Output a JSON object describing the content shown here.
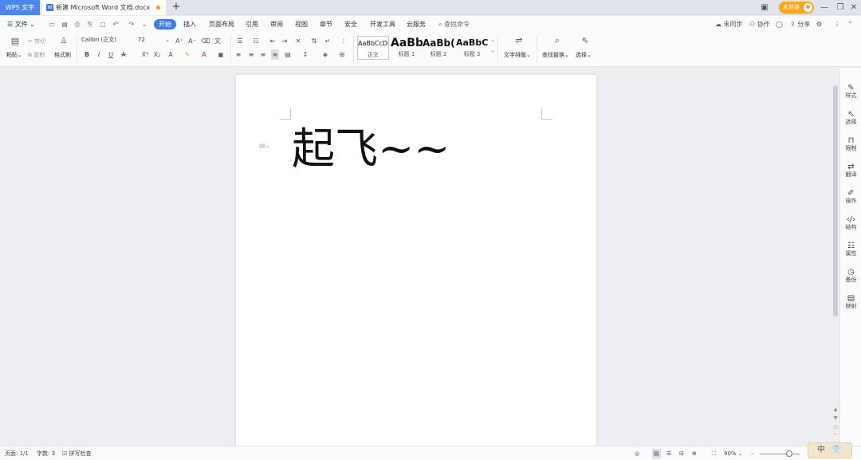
{
  "titlebar": {
    "app_tab": "WPS 文字",
    "doc_name": "新建 Microsoft Word 文档.docx",
    "doc_icon_letter": "W",
    "new_tab": "+",
    "login": "未登录"
  },
  "menu": {
    "file": "文件",
    "tabs": [
      "开始",
      "插入",
      "页面布局",
      "引用",
      "审阅",
      "视图",
      "章节",
      "安全",
      "开发工具",
      "云服务"
    ],
    "search": "查找命令",
    "right": [
      "未同步",
      "协作",
      "分享"
    ]
  },
  "ribbon": {
    "paste": "粘贴",
    "cut": "剪切",
    "copy": "复制",
    "format_painter": "格式刷",
    "font_name": "Calibri (正文)",
    "font_size": "72",
    "styles": [
      {
        "sample": "AaBbCcDd",
        "name": "正文"
      },
      {
        "sample": "AaBb",
        "name": "标题 1"
      },
      {
        "sample": "AaBb(",
        "name": "标题 2"
      },
      {
        "sample": "AaBbC",
        "name": "标题 3"
      }
    ],
    "text_layout": "文字排版",
    "find_replace": "查找替换",
    "select": "选择"
  },
  "document": {
    "text": "起飞~~"
  },
  "right_panel": [
    "样式",
    "选择",
    "限制",
    "翻译",
    "操作",
    "结构",
    "属性",
    "备份",
    "映射"
  ],
  "status": {
    "page": "页面: 1/1",
    "word_count": "字数: 3",
    "spell_check": "拼写检查",
    "zoom": "90%"
  },
  "ime": {
    "lang": "中"
  },
  "colors": {
    "accent": "#3d7ce8",
    "app_tab": "#4a88f0",
    "login": "#f5a623",
    "unsaved_dot": "#f0a11b"
  }
}
